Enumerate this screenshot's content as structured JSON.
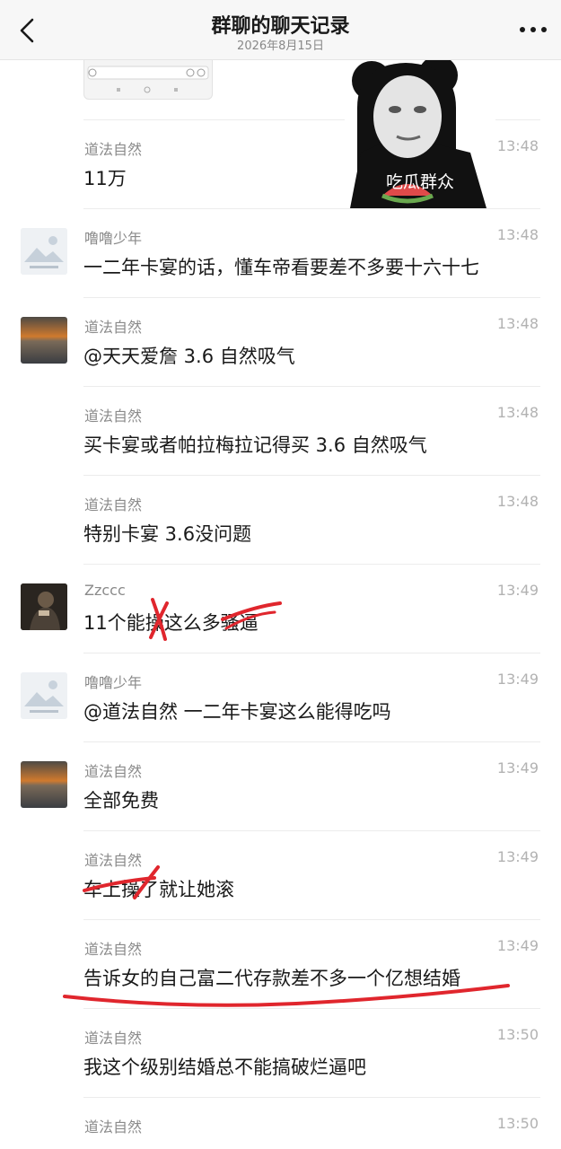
{
  "header": {
    "title": "群聊的聊天记录",
    "subtitle": "2026年8月15日"
  },
  "sticker": {
    "caption": "吃瓜群众"
  },
  "messages": [
    {
      "sender": "道法自然",
      "time": "13:48",
      "text": "11万",
      "avatar": "none"
    },
    {
      "sender": "噜噜少年",
      "time": "13:48",
      "text": "一二年卡宴的话，懂车帝看要差不多要十六十七",
      "avatar": "mountain"
    },
    {
      "sender": "道法自然",
      "time": "13:48",
      "text": "@天天爱詹 3.6 自然吸气",
      "avatar": "sunset"
    },
    {
      "sender": "道法自然",
      "time": "13:48",
      "text": "买卡宴或者帕拉梅拉记得买 3.6 自然吸气",
      "avatar": "none"
    },
    {
      "sender": "道法自然",
      "time": "13:48",
      "text": "特别卡宴 3.6没问题",
      "avatar": "none"
    },
    {
      "sender": "Zzccc",
      "time": "13:49",
      "text": "11个能操这么多骚逼",
      "avatar": "dark"
    },
    {
      "sender": "噜噜少年",
      "time": "13:49",
      "text": "@道法自然 一二年卡宴这么能得吃吗",
      "avatar": "mountain"
    },
    {
      "sender": "道法自然",
      "time": "13:49",
      "text": "全部免费",
      "avatar": "sunset"
    },
    {
      "sender": "道法自然",
      "time": "13:49",
      "text": "车上操了就让她滚",
      "avatar": "none"
    },
    {
      "sender": "道法自然",
      "time": "13:49",
      "text": "告诉女的自己富二代存款差不多一个亿想结婚",
      "avatar": "none"
    },
    {
      "sender": "道法自然",
      "time": "13:50",
      "text": "我这个级别结婚总不能搞破烂逼吧",
      "avatar": "none"
    },
    {
      "sender": "道法自然",
      "time": "13:50",
      "text": "",
      "avatar": "none"
    }
  ],
  "colors": {
    "nav_bg": "#f7f7f7",
    "name": "#8a8a8a",
    "time": "#b2b2b2",
    "annotation": "#e0262d"
  }
}
